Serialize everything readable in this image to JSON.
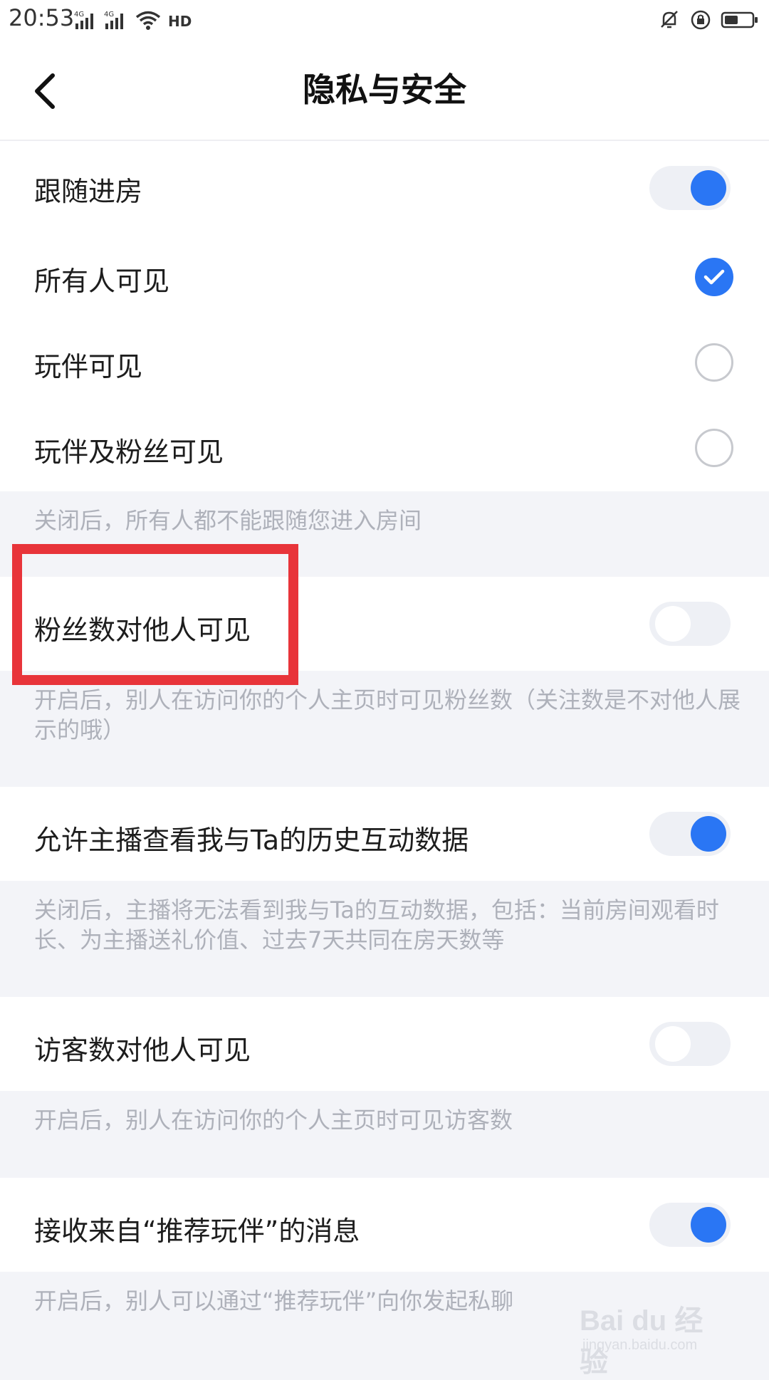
{
  "status_bar": {
    "time": "20:53",
    "network_1": "4G",
    "network_2": "4G",
    "hd_label": "HD"
  },
  "header": {
    "title": "隐私与安全",
    "back_icon": "chevron-left-icon"
  },
  "follow_section": {
    "title": "跟随进房",
    "enabled": true,
    "options": [
      {
        "label": "所有人可见",
        "selected": true
      },
      {
        "label": "玩伴可见",
        "selected": false
      },
      {
        "label": "玩伴及粉丝可见",
        "selected": false
      }
    ],
    "note": "关闭后，所有人都不能跟随您进入房间"
  },
  "settings": [
    {
      "label": "粉丝数对他人可见",
      "enabled": false,
      "note": "开启后，别人在访问你的个人主页时可见粉丝数（关注数是不对他人展示的哦）"
    },
    {
      "label": "允许主播查看我与Ta的历史互动数据",
      "enabled": true,
      "note": "关闭后，主播将无法看到我与Ta的互动数据，包括：当前房间观看时长、为主播送礼价值、过去7天共同在房天数等"
    },
    {
      "label": "访客数对他人可见",
      "enabled": false,
      "note": "开启后，别人在访问你的个人主页时可见访客数"
    },
    {
      "label": "接收来自“推荐玩伴”的消息",
      "enabled": true,
      "note": "开启后，别人可以通过“推荐玩伴”向你发起私聊"
    }
  ],
  "colors": {
    "accent": "#2a76f4",
    "highlight": "#e8343a",
    "background": "#f3f4f8",
    "note_text": "#aeb1ba"
  },
  "watermark": {
    "brand": "Bai du 经验",
    "url": "jingyan.baidu.com"
  }
}
